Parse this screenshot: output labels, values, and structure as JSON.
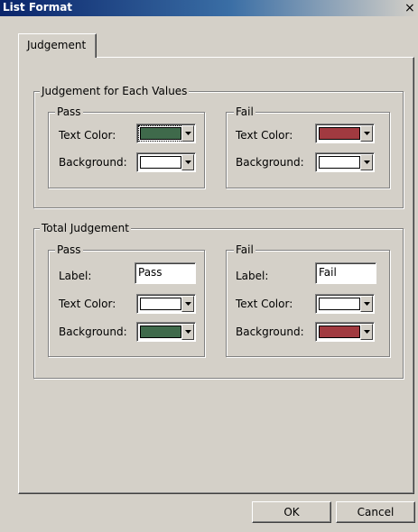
{
  "window": {
    "title": "List Format",
    "close_glyph": "×"
  },
  "tabs": [
    {
      "label": "Judgement"
    }
  ],
  "each_values": {
    "title": "Judgement for Each Values",
    "pass": {
      "title": "Pass",
      "text_color_label": "Text Color:",
      "text_color": "#3f6a4b",
      "background_label": "Background:",
      "background": "#ffffff"
    },
    "fail": {
      "title": "Fail",
      "text_color_label": "Text Color:",
      "text_color": "#a13a40",
      "background_label": "Background:",
      "background": "#ffffff"
    }
  },
  "total": {
    "title": "Total Judgement",
    "pass": {
      "title": "Pass",
      "label_caption": "Label:",
      "label_value": "Pass",
      "text_color_label": "Text Color:",
      "text_color": "#ffffff",
      "background_label": "Background:",
      "background": "#3f6a4b"
    },
    "fail": {
      "title": "Fail",
      "label_caption": "Label:",
      "label_value": "Fail",
      "text_color_label": "Text Color:",
      "text_color": "#ffffff",
      "background_label": "Background:",
      "background": "#a13a40"
    }
  },
  "buttons": {
    "ok": "OK",
    "cancel": "Cancel"
  },
  "icons": {
    "dropdown": "chevron-down-icon",
    "close": "close-icon"
  }
}
